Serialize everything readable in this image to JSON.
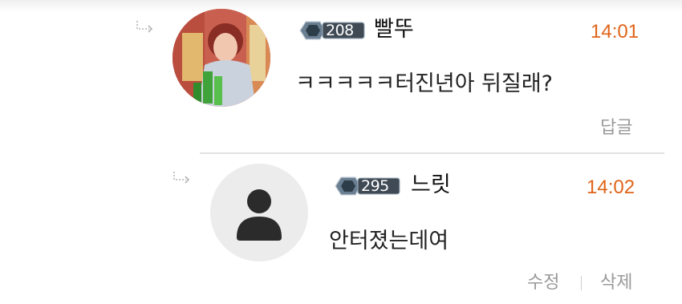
{
  "comments": [
    {
      "level": "208",
      "username": "빨뚜",
      "time": "14:01",
      "message": "ㅋㅋㅋㅋㅋ터진년아 뒤질래?",
      "actions": [
        "답글"
      ]
    },
    {
      "level": "295",
      "username": "느릿",
      "time": "14:02",
      "message": "안터졌는데여",
      "actions": [
        "수정",
        "삭제"
      ]
    }
  ],
  "colors": {
    "time": "#e06418",
    "action": "#9a9a9a",
    "badge_bg": "#3f4a55",
    "default_avatar_bg": "#ececec"
  }
}
